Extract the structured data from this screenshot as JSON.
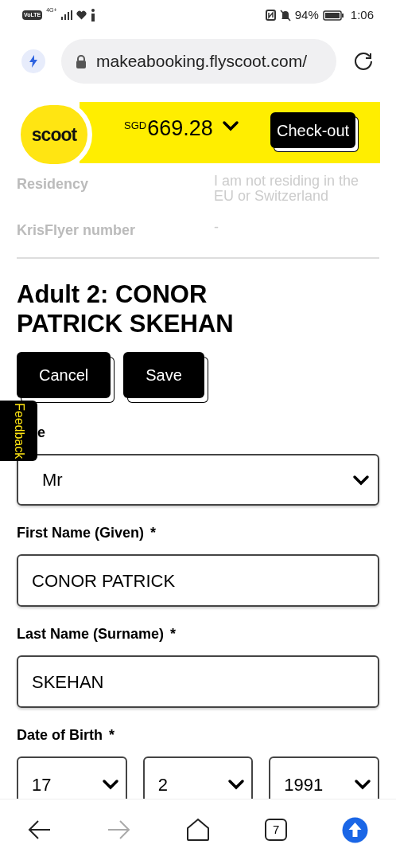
{
  "status_bar": {
    "volte": "VoLTE",
    "network": "4G+",
    "battery": "94%",
    "time": "1:06"
  },
  "browser": {
    "url": "makeabooking.flyscoot.com/",
    "tabs_count": "7"
  },
  "header": {
    "logo": "scoot",
    "currency": "SGD",
    "total": "669.28",
    "checkout": "Check-out"
  },
  "summary": [
    {
      "label": "Residency",
      "value": "I am not residing in the EU or Switzerland"
    },
    {
      "label": "KrisFlyer number",
      "value": "-"
    }
  ],
  "passenger": {
    "heading": "Adult 2: CONOR PATRICK SKEHAN",
    "buttons": [
      "Cancel",
      "Save"
    ]
  },
  "feedback": "Feedback",
  "fields": [
    {
      "kind": "select",
      "label": "e",
      "value": "Mr"
    },
    {
      "kind": "text",
      "label": "First Name (Given)",
      "mark": "*",
      "value": "CONOR PATRICK"
    },
    {
      "kind": "text",
      "label": "Last Name (Surname)",
      "mark": "*",
      "value": "SKEHAN"
    },
    {
      "kind": "date",
      "label": "Date of Birth",
      "mark": "*",
      "parts": [
        "17",
        "2",
        "1991"
      ]
    }
  ]
}
